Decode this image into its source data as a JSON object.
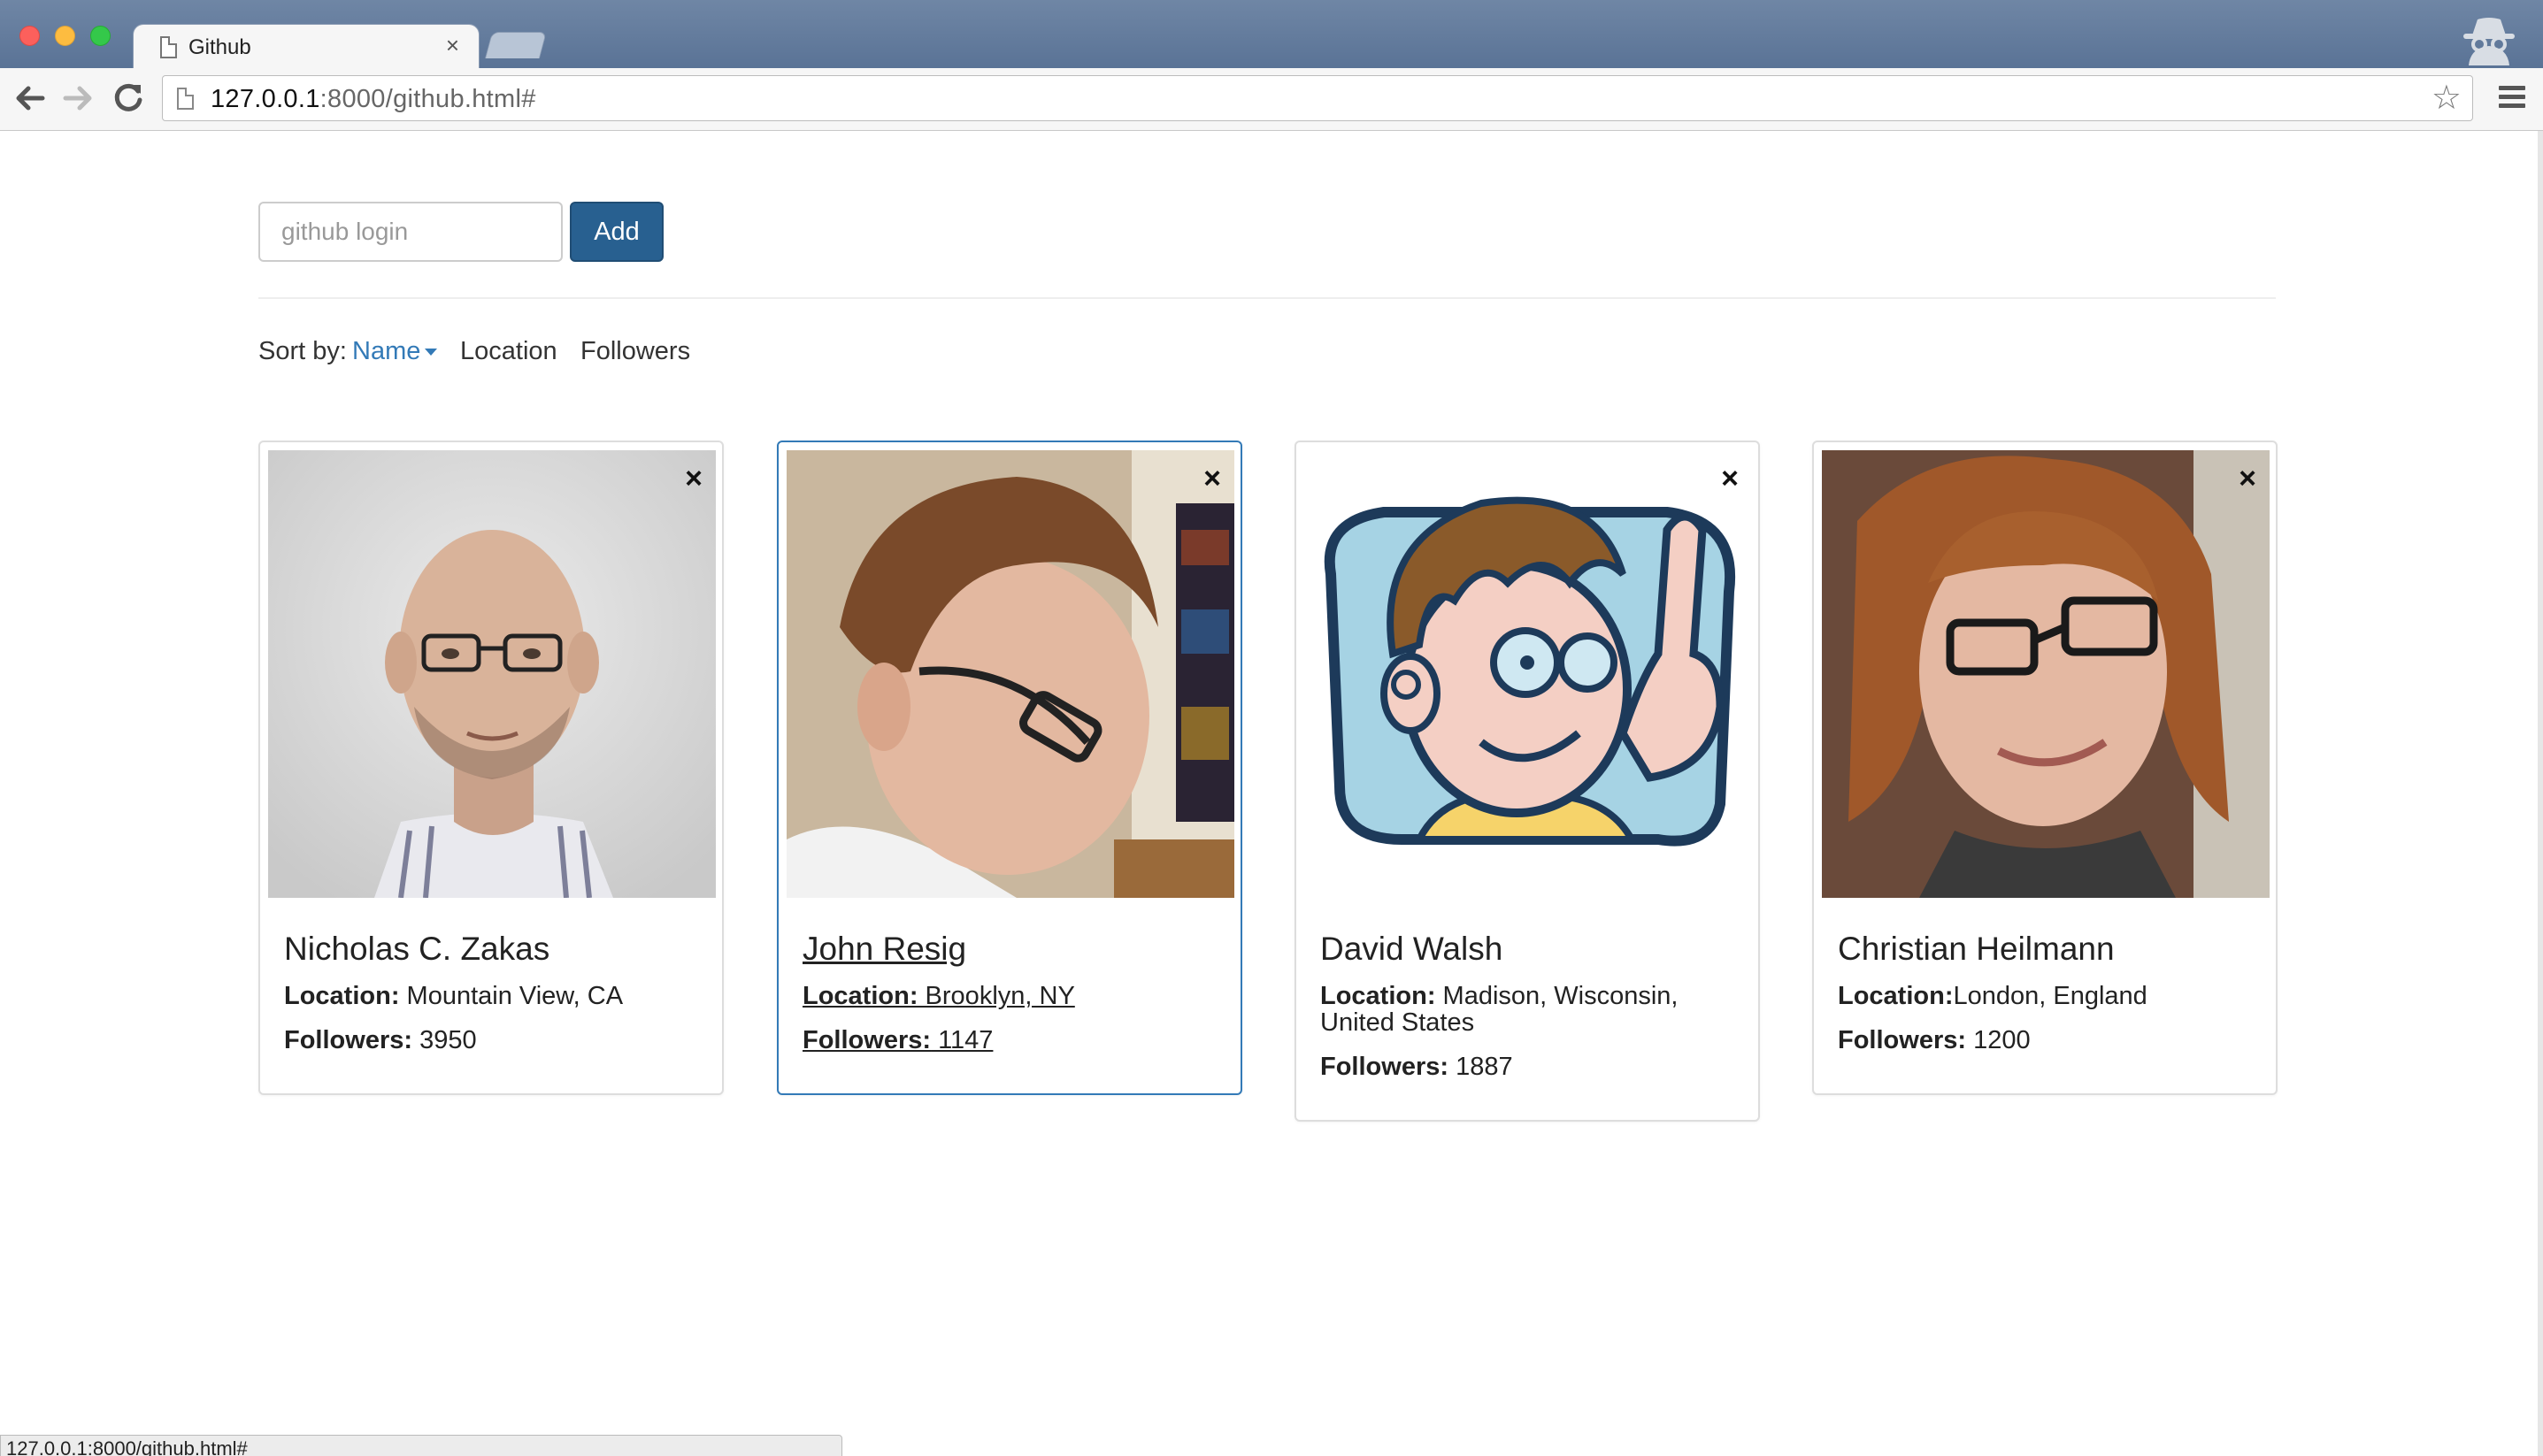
{
  "browser": {
    "tab_title": "Github",
    "tab_close": "×",
    "url_host": "127.0.0.1",
    "url_rest": ":8000/github.html#",
    "status_url": "127.0.0.1:8000/github.html#"
  },
  "form": {
    "placeholder": "github login",
    "value": "",
    "add_label": "Add"
  },
  "sort": {
    "label": "Sort by:",
    "options": [
      "Name",
      "Location",
      "Followers"
    ],
    "active": "Name"
  },
  "cards": [
    {
      "name": "Nicholas C. Zakas",
      "location_label": "Location:",
      "location": " Mountain View, CA",
      "followers_label": "Followers:",
      "followers": " 3950",
      "remove": "×"
    },
    {
      "name": "John Resig",
      "location_label": "Location:",
      "location": " Brooklyn, NY",
      "followers_label": "Followers:",
      "followers": " 1147",
      "remove": "×"
    },
    {
      "name": "David Walsh",
      "location_label": "Location:",
      "location": " Madison, Wisconsin, United States",
      "followers_label": "Followers:",
      "followers": " 1887",
      "remove": "×"
    },
    {
      "name": "Christian Heilmann",
      "location_label": "Location:",
      "location": "London, England",
      "followers_label": "Followers:",
      "followers": " 1200",
      "remove": "×"
    }
  ],
  "colors": {
    "primary": "#286090",
    "link": "#337ab7",
    "titlebar": "#5a7396"
  }
}
